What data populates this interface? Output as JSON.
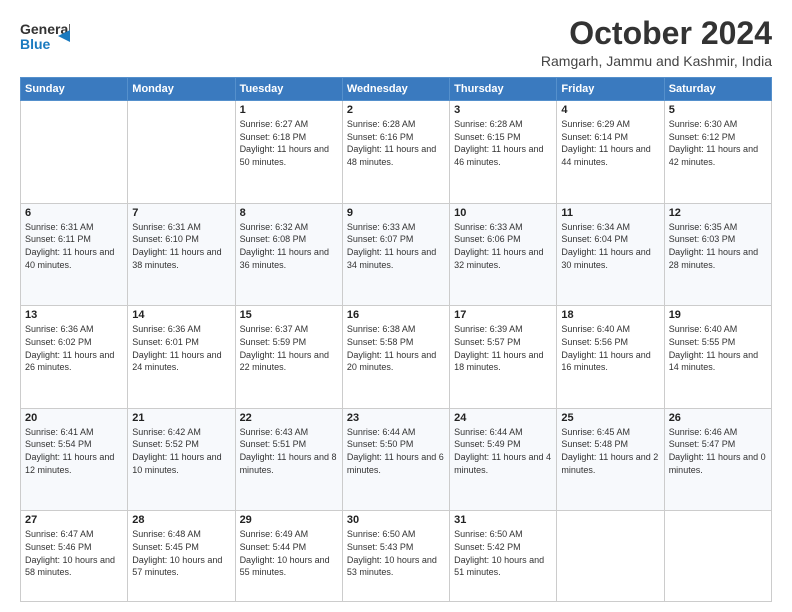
{
  "header": {
    "logo": {
      "general": "General",
      "blue": "Blue",
      "tagline": "GeneralBlue"
    },
    "title": "October 2024",
    "location": "Ramgarh, Jammu and Kashmir, India"
  },
  "days_of_week": [
    "Sunday",
    "Monday",
    "Tuesday",
    "Wednesday",
    "Thursday",
    "Friday",
    "Saturday"
  ],
  "weeks": [
    [
      {
        "day": "",
        "content": ""
      },
      {
        "day": "",
        "content": ""
      },
      {
        "day": "1",
        "content": "Sunrise: 6:27 AM\nSunset: 6:18 PM\nDaylight: 11 hours and 50 minutes."
      },
      {
        "day": "2",
        "content": "Sunrise: 6:28 AM\nSunset: 6:16 PM\nDaylight: 11 hours and 48 minutes."
      },
      {
        "day": "3",
        "content": "Sunrise: 6:28 AM\nSunset: 6:15 PM\nDaylight: 11 hours and 46 minutes."
      },
      {
        "day": "4",
        "content": "Sunrise: 6:29 AM\nSunset: 6:14 PM\nDaylight: 11 hours and 44 minutes."
      },
      {
        "day": "5",
        "content": "Sunrise: 6:30 AM\nSunset: 6:12 PM\nDaylight: 11 hours and 42 minutes."
      }
    ],
    [
      {
        "day": "6",
        "content": "Sunrise: 6:31 AM\nSunset: 6:11 PM\nDaylight: 11 hours and 40 minutes."
      },
      {
        "day": "7",
        "content": "Sunrise: 6:31 AM\nSunset: 6:10 PM\nDaylight: 11 hours and 38 minutes."
      },
      {
        "day": "8",
        "content": "Sunrise: 6:32 AM\nSunset: 6:08 PM\nDaylight: 11 hours and 36 minutes."
      },
      {
        "day": "9",
        "content": "Sunrise: 6:33 AM\nSunset: 6:07 PM\nDaylight: 11 hours and 34 minutes."
      },
      {
        "day": "10",
        "content": "Sunrise: 6:33 AM\nSunset: 6:06 PM\nDaylight: 11 hours and 32 minutes."
      },
      {
        "day": "11",
        "content": "Sunrise: 6:34 AM\nSunset: 6:04 PM\nDaylight: 11 hours and 30 minutes."
      },
      {
        "day": "12",
        "content": "Sunrise: 6:35 AM\nSunset: 6:03 PM\nDaylight: 11 hours and 28 minutes."
      }
    ],
    [
      {
        "day": "13",
        "content": "Sunrise: 6:36 AM\nSunset: 6:02 PM\nDaylight: 11 hours and 26 minutes."
      },
      {
        "day": "14",
        "content": "Sunrise: 6:36 AM\nSunset: 6:01 PM\nDaylight: 11 hours and 24 minutes."
      },
      {
        "day": "15",
        "content": "Sunrise: 6:37 AM\nSunset: 5:59 PM\nDaylight: 11 hours and 22 minutes."
      },
      {
        "day": "16",
        "content": "Sunrise: 6:38 AM\nSunset: 5:58 PM\nDaylight: 11 hours and 20 minutes."
      },
      {
        "day": "17",
        "content": "Sunrise: 6:39 AM\nSunset: 5:57 PM\nDaylight: 11 hours and 18 minutes."
      },
      {
        "day": "18",
        "content": "Sunrise: 6:40 AM\nSunset: 5:56 PM\nDaylight: 11 hours and 16 minutes."
      },
      {
        "day": "19",
        "content": "Sunrise: 6:40 AM\nSunset: 5:55 PM\nDaylight: 11 hours and 14 minutes."
      }
    ],
    [
      {
        "day": "20",
        "content": "Sunrise: 6:41 AM\nSunset: 5:54 PM\nDaylight: 11 hours and 12 minutes."
      },
      {
        "day": "21",
        "content": "Sunrise: 6:42 AM\nSunset: 5:52 PM\nDaylight: 11 hours and 10 minutes."
      },
      {
        "day": "22",
        "content": "Sunrise: 6:43 AM\nSunset: 5:51 PM\nDaylight: 11 hours and 8 minutes."
      },
      {
        "day": "23",
        "content": "Sunrise: 6:44 AM\nSunset: 5:50 PM\nDaylight: 11 hours and 6 minutes."
      },
      {
        "day": "24",
        "content": "Sunrise: 6:44 AM\nSunset: 5:49 PM\nDaylight: 11 hours and 4 minutes."
      },
      {
        "day": "25",
        "content": "Sunrise: 6:45 AM\nSunset: 5:48 PM\nDaylight: 11 hours and 2 minutes."
      },
      {
        "day": "26",
        "content": "Sunrise: 6:46 AM\nSunset: 5:47 PM\nDaylight: 11 hours and 0 minutes."
      }
    ],
    [
      {
        "day": "27",
        "content": "Sunrise: 6:47 AM\nSunset: 5:46 PM\nDaylight: 10 hours and 58 minutes."
      },
      {
        "day": "28",
        "content": "Sunrise: 6:48 AM\nSunset: 5:45 PM\nDaylight: 10 hours and 57 minutes."
      },
      {
        "day": "29",
        "content": "Sunrise: 6:49 AM\nSunset: 5:44 PM\nDaylight: 10 hours and 55 minutes."
      },
      {
        "day": "30",
        "content": "Sunrise: 6:50 AM\nSunset: 5:43 PM\nDaylight: 10 hours and 53 minutes."
      },
      {
        "day": "31",
        "content": "Sunrise: 6:50 AM\nSunset: 5:42 PM\nDaylight: 10 hours and 51 minutes."
      },
      {
        "day": "",
        "content": ""
      },
      {
        "day": "",
        "content": ""
      }
    ]
  ]
}
